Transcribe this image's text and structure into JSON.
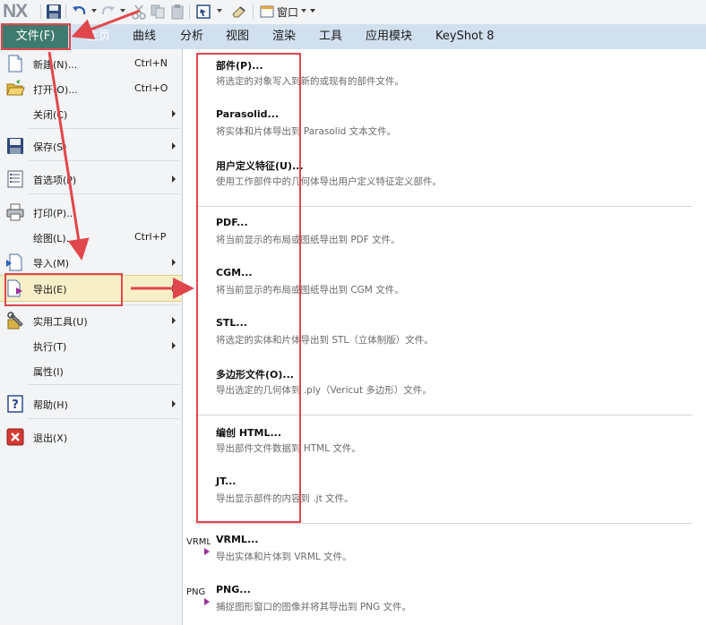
{
  "app": {
    "logo": "NX",
    "window_menu": "窗口"
  },
  "qat_icons": [
    "save-icon",
    "undo-icon",
    "redo-icon",
    "cut-icon",
    "copy-icon",
    "paste-icon",
    "touch-mode-icon",
    "eraser-icon",
    "window-icon"
  ],
  "tabs": [
    {
      "label": "文件(F)"
    },
    {
      "label": "主页"
    },
    {
      "label": "曲线"
    },
    {
      "label": "分析"
    },
    {
      "label": "视图"
    },
    {
      "label": "渲染"
    },
    {
      "label": "工具"
    },
    {
      "label": "应用模块"
    },
    {
      "label": "KeyShot 8"
    }
  ],
  "file_menu": [
    {
      "label": "新建(N)...",
      "shortcut": "Ctrl+N",
      "icon": "new-file-icon"
    },
    {
      "label": "打开(O)...",
      "shortcut": "Ctrl+O",
      "icon": "open-folder-icon"
    },
    {
      "label": "关闭(C)",
      "shortcut": "",
      "icon": ""
    },
    {
      "label": "保存(S)",
      "shortcut": "",
      "icon": "save-icon"
    },
    {
      "label": "首选项(P)",
      "shortcut": "",
      "icon": "preferences-icon"
    },
    {
      "label": "打印(P)...",
      "shortcut": "",
      "icon": "printer-icon"
    },
    {
      "label": "绘图(L)...",
      "shortcut": "Ctrl+P",
      "icon": ""
    },
    {
      "label": "导入(M)",
      "shortcut": "",
      "icon": "import-icon"
    },
    {
      "label": "导出(E)",
      "shortcut": "",
      "icon": "export-icon"
    },
    {
      "label": "实用工具(U)",
      "shortcut": "",
      "icon": "utilities-icon"
    },
    {
      "label": "执行(T)",
      "shortcut": "",
      "icon": ""
    },
    {
      "label": "属性(I)",
      "shortcut": "",
      "icon": ""
    },
    {
      "label": "帮助(H)",
      "shortcut": "",
      "icon": "help-icon"
    },
    {
      "label": "退出(X)",
      "shortcut": "",
      "icon": "exit-icon"
    }
  ],
  "export_menu": [
    {
      "title": "部件(P)...",
      "desc": "将选定的对象写入到新的或现有的部件文件。"
    },
    {
      "title": "Parasolid...",
      "desc": "将实体和片体导出到 Parasolid 文本文件。"
    },
    {
      "title": "用户定义特征(U)...",
      "desc": "使用工作部件中的几何体导出用户定义特征定义部件。"
    },
    {
      "title": "PDF...",
      "desc": "将当前显示的布局或图纸导出到 PDF 文件。"
    },
    {
      "title": "CGM...",
      "desc": "将当前显示的布局或图纸导出到 CGM 文件。"
    },
    {
      "title": "STL...",
      "desc": "将选定的实体和片体导出到 STL（立体制版）文件。"
    },
    {
      "title": "多边形文件(O)...",
      "desc": "导出选定的几何体到 .ply（Vericut 多边形）文件。"
    },
    {
      "title": "编创 HTML...",
      "desc": "导出部件文件数据到 HTML 文件。"
    },
    {
      "title": "JT...",
      "desc": "导出显示部件的内容到 .jt 文件。"
    },
    {
      "title": "VRML...",
      "desc": "导出实体和片体到 VRML 文件。",
      "icon_label": "VRML"
    },
    {
      "title": "PNG...",
      "desc": "捕捉图形窗口的图像并将其导出到 PNG 文件。",
      "icon_label": "PNG"
    }
  ],
  "colors": {
    "annotation_red": "#e0474c",
    "file_tab": "#3e7b6e",
    "ribbon": "#d1e0ef",
    "highlight": "#f7efc8"
  }
}
